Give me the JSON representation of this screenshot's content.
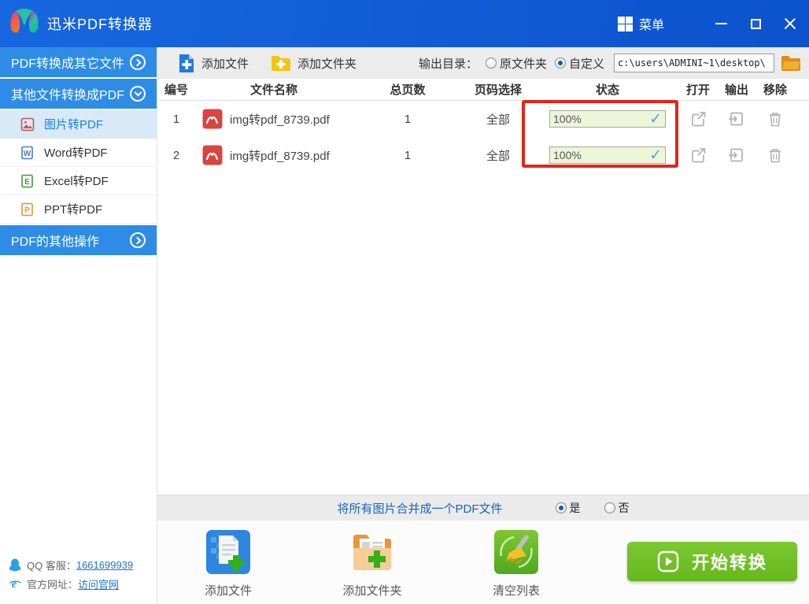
{
  "titlebar": {
    "app_title": "迅米PDF转换器",
    "menu_label": "菜单"
  },
  "sidebar": {
    "sections": [
      {
        "label": "PDF转换成其它文件",
        "state": "collapsed"
      },
      {
        "label": "其他文件转换成PDF",
        "state": "expanded"
      },
      {
        "label": "PDF的其他操作",
        "state": "collapsed"
      }
    ],
    "items": [
      {
        "label": "图片转PDF",
        "selected": true
      },
      {
        "label": "Word转PDF",
        "selected": false
      },
      {
        "label": "Excel转PDF",
        "selected": false
      },
      {
        "label": "PPT转PDF",
        "selected": false
      }
    ],
    "contacts": [
      {
        "label": "QQ 客服：",
        "link": "1661699939"
      },
      {
        "label": "官方网址：",
        "link": "访问官网"
      }
    ]
  },
  "toolbar": {
    "add_file": "添加文件",
    "add_folder": "添加文件夹",
    "output_dir_label": "输出目录：",
    "radio_original": "原文件夹",
    "radio_custom": "自定义",
    "custom_selected": true,
    "path_value": "c:\\users\\ADMINI~1\\desktop\\"
  },
  "table": {
    "headers": [
      "编号",
      "文件名称",
      "总页数",
      "页码选择",
      "状态",
      "打开",
      "输出",
      "移除"
    ],
    "rows": [
      {
        "num": "1",
        "name": "img转pdf_8739.pdf",
        "pages": "1",
        "range": "全部",
        "progress": "100%"
      },
      {
        "num": "2",
        "name": "img转pdf_8739.pdf",
        "pages": "1",
        "range": "全部",
        "progress": "100%"
      }
    ]
  },
  "merge_bar": {
    "label": "将所有图片合并成一个PDF文件",
    "yes_label": "是",
    "no_label": "否",
    "selected": "yes"
  },
  "footer": {
    "actions": [
      {
        "label": "添加文件"
      },
      {
        "label": "添加文件夹"
      },
      {
        "label": "清空列表"
      }
    ],
    "start_button": "开始转换"
  },
  "icons": {
    "check": "✓"
  },
  "colors": {
    "titlebar_blue": "#0c52cd",
    "sidebar_blue": "#2e8ce6",
    "selected_item_bg": "#d8eaf8",
    "accent_link": "#1a73d9",
    "progress_bg": "#edf6d9",
    "annotation_red": "#e3251b",
    "start_green": "#6cbd22"
  }
}
